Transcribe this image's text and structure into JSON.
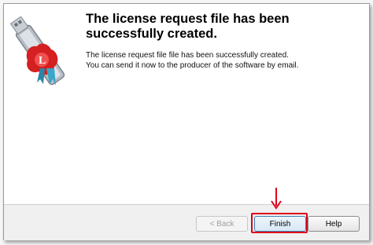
{
  "dialog": {
    "title": "The license request file has been successfully created.",
    "message_line1": "The license request file file has been successfully created.",
    "message_line2": "You can send it now to the producer of the software by email."
  },
  "buttons": {
    "back": "< Back",
    "finish": "Finish",
    "help": "Help"
  },
  "icons": {
    "logo": "usb-key-license-icon",
    "annotation_arrow": "red-down-arrow-icon"
  },
  "colors": {
    "highlight": "#e0001b",
    "seal": "#d42020"
  }
}
